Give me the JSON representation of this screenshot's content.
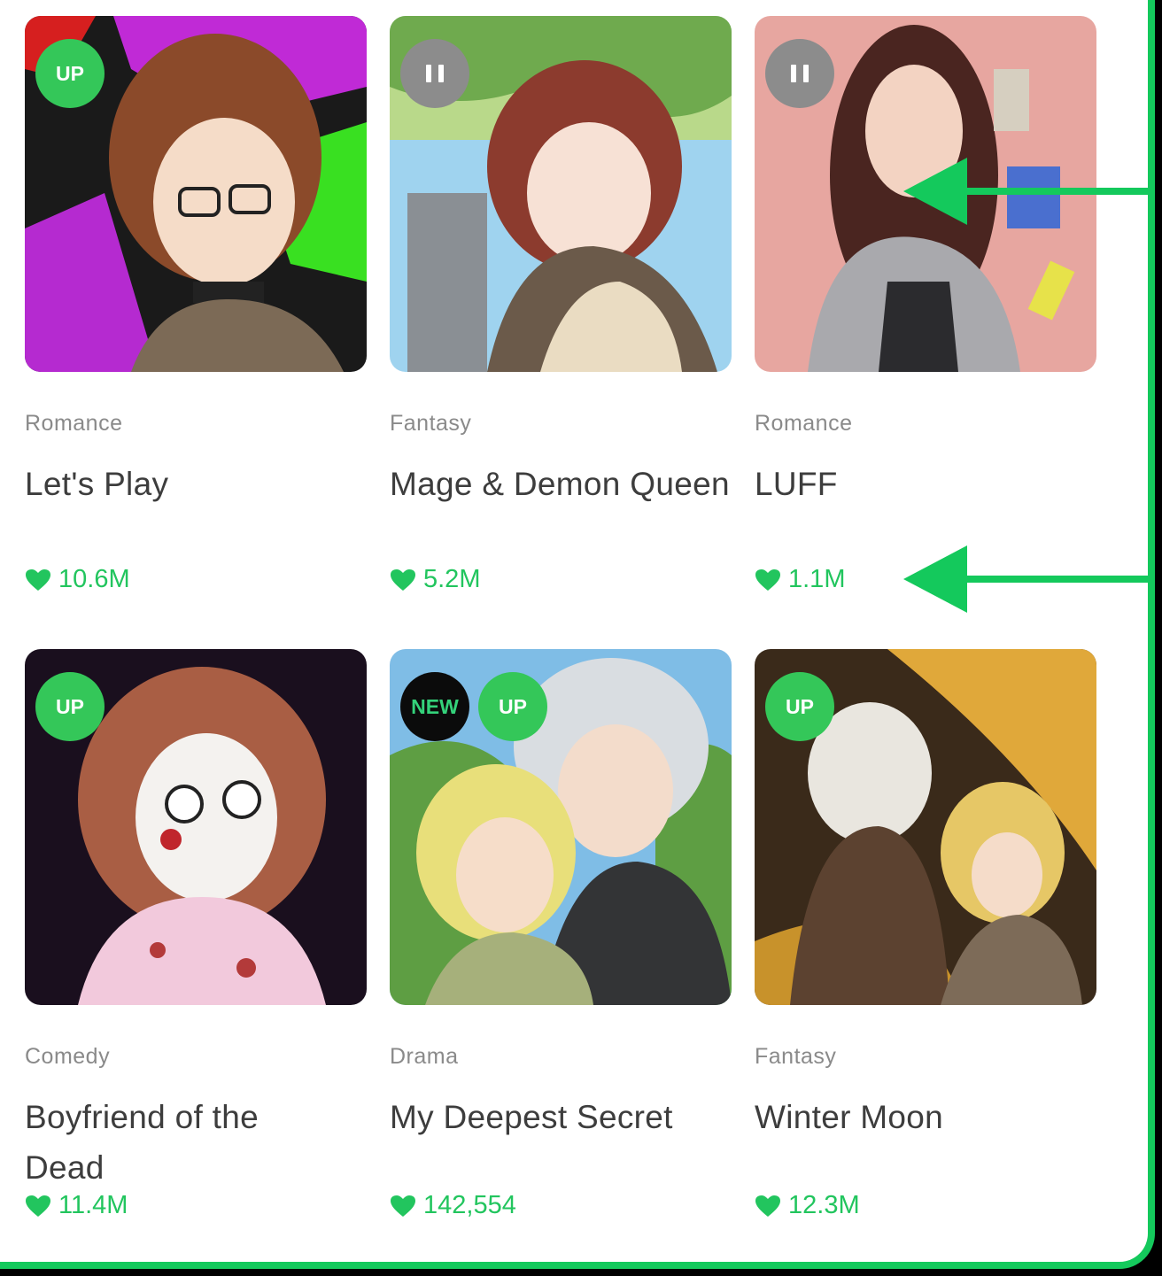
{
  "colors": {
    "accent_green": "#14c95c",
    "likes_green": "#22c55e",
    "up_badge": "#34c759",
    "pause_badge": "#8c8c8c",
    "new_badge": "#0b0b0b"
  },
  "cards": [
    {
      "genre": "Romance",
      "title": "Let's Play",
      "likes": "10.6M",
      "badges": [
        {
          "type": "up",
          "label": "UP"
        }
      ]
    },
    {
      "genre": "Fantasy",
      "title": "Mage & Demon Queen",
      "likes": "5.2M",
      "badges": [
        {
          "type": "pause",
          "label": "pause-icon"
        }
      ]
    },
    {
      "genre": "Romance",
      "title": "LUFF",
      "likes": "1.1M",
      "badges": [
        {
          "type": "pause",
          "label": "pause-icon"
        }
      ]
    },
    {
      "genre": "Comedy",
      "title": "Boyfriend of the Dead",
      "likes": "11.4M",
      "badges": [
        {
          "type": "up",
          "label": "UP"
        }
      ]
    },
    {
      "genre": "Drama",
      "title": "My Deepest Secret",
      "likes": "142,554",
      "badges": [
        {
          "type": "new",
          "label": "NEW"
        },
        {
          "type": "up",
          "label": "UP"
        }
      ]
    },
    {
      "genre": "Fantasy",
      "title": "Winter Moon",
      "likes": "12.3M",
      "badges": [
        {
          "type": "up",
          "label": "UP"
        }
      ]
    }
  ]
}
